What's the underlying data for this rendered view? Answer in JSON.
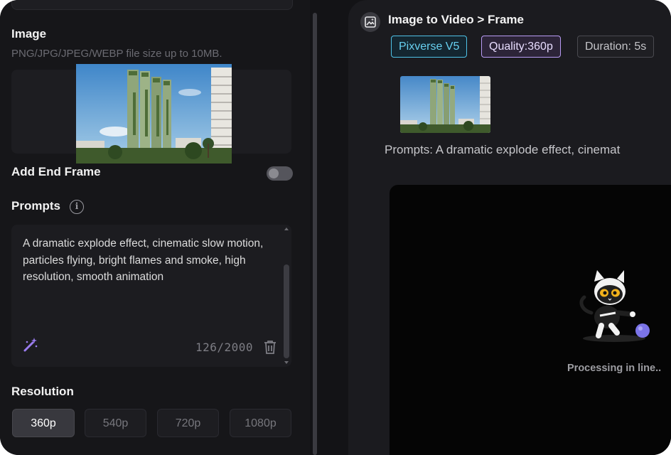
{
  "left_panel": {
    "image_section": {
      "title": "Image",
      "hint": "PNG/JPG/JPEG/WEBP file size up to 10MB."
    },
    "end_frame": {
      "label": "Add End Frame",
      "enabled": false
    },
    "prompts": {
      "title": "Prompts",
      "info_icon": "info-icon",
      "text": "A dramatic explode effect, cinematic slow motion, particles flying, bright flames and smoke, high resolution, smooth animation",
      "counter": "126/2000",
      "wand_icon": "magic-wand-icon",
      "trash_icon": "trash-icon"
    },
    "resolution": {
      "title": "Resolution",
      "options": [
        "360p",
        "540p",
        "720p",
        "1080p"
      ],
      "selected": "360p"
    }
  },
  "right_panel": {
    "breadcrumb": "Image to Video > Frame",
    "tags": {
      "model": "Pixverse V5",
      "quality": "Quality:360p",
      "duration": "Duration: 5s"
    },
    "prompt_line": "Prompts: A dramatic explode effect, cinemat",
    "status": "Processing in line..",
    "colors": {
      "model_accent": "#4fc3e8",
      "quality_accent": "#b99cf5",
      "wand_accent": "#9b7cf0"
    }
  }
}
